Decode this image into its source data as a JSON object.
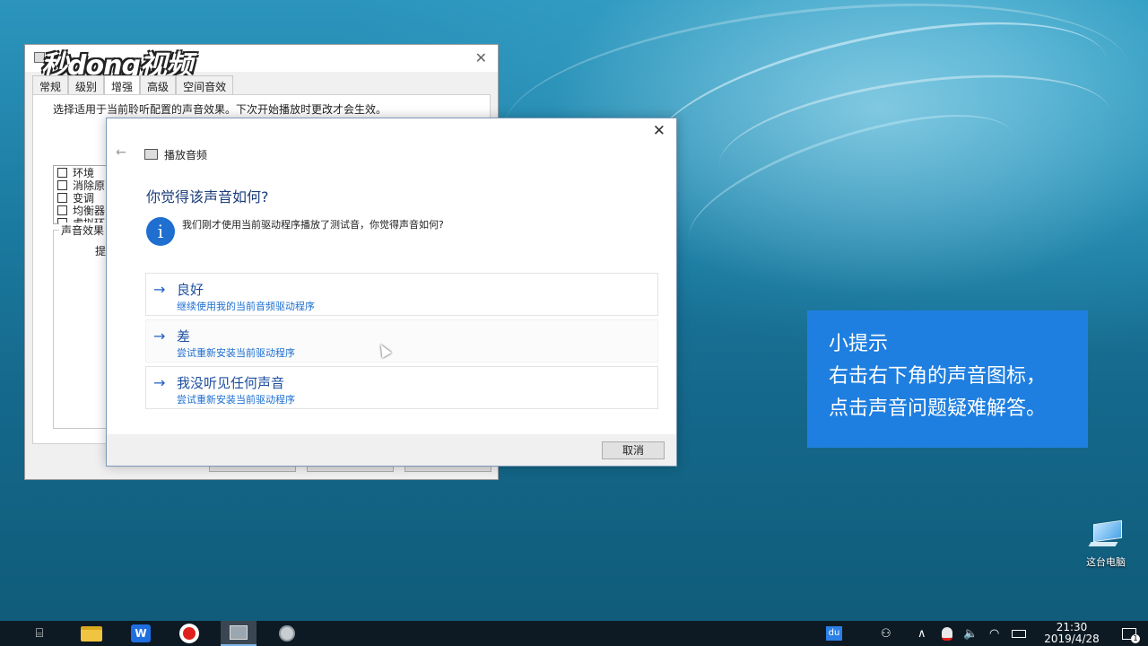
{
  "watermark": {
    "logo_text": "秒dong视频"
  },
  "back_window": {
    "tabs": [
      {
        "label": "常规"
      },
      {
        "label": "级别"
      },
      {
        "label": "增强"
      },
      {
        "label": "高级"
      },
      {
        "label": "空间音效"
      }
    ],
    "description": "选择适用于当前聆听配置的声音效果。下次开始播放时更改才会生效。",
    "effects": [
      {
        "label": "环境"
      },
      {
        "label": "消除原"
      },
      {
        "label": "变调"
      },
      {
        "label": "均衡器"
      },
      {
        "label": "虚拟环"
      }
    ],
    "group_label": "声音效果",
    "group_text": "提"
  },
  "dialog": {
    "close_symbol": "✕",
    "back_symbol": "←",
    "app_title": "播放音频",
    "heading": "你觉得该声音如何?",
    "info_glyph": "i",
    "info_text": "我们刚才使用当前驱动程序播放了测试音，你觉得声音如何?",
    "arrow": "→",
    "options": [
      {
        "title": "良好",
        "subtitle": "继续使用我的当前音频驱动程序"
      },
      {
        "title": "差",
        "subtitle": "尝试重新安装当前驱动程序"
      },
      {
        "title": "我没听见任何声音",
        "subtitle": "尝试重新安装当前驱动程序"
      }
    ],
    "cancel_label": "取消"
  },
  "tip": {
    "line1": "小提示",
    "line2": "右击右下角的声音图标，",
    "line3": "点击声音问题疑难解答。"
  },
  "desktop": {
    "this_pc_label": "这台电脑"
  },
  "taskbar": {
    "wps_glyph": "W",
    "du_glyph": "du",
    "time": "21:30",
    "date": "2019/4/28",
    "notification_count": "1"
  },
  "colors": {
    "accent": "#1e6fd0",
    "tip_background": "#1f7fe0",
    "link": "#1e4fa0"
  }
}
